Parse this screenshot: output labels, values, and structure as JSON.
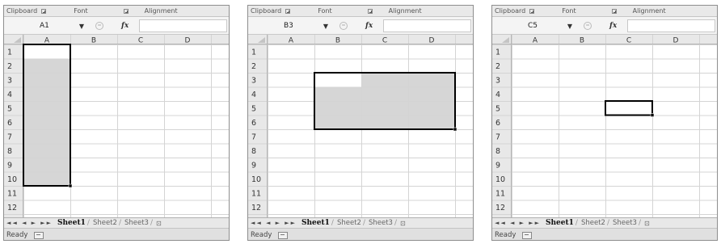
{
  "ribbon_groups": [
    "Clipboard",
    "Font",
    "Alignment"
  ],
  "columns": [
    "A",
    "B",
    "C",
    "D"
  ],
  "rows": [
    "1",
    "2",
    "3",
    "4",
    "5",
    "6",
    "7",
    "8",
    "9",
    "10",
    "11",
    "12"
  ],
  "sheet_tabs": [
    "Sheet1",
    "Sheet2",
    "Sheet3"
  ],
  "status_text": "Ready",
  "formula_symbol": "fx",
  "colors": {
    "selection_fill": "#d6d6d6",
    "selection_border": "#000000",
    "header_bg": "#e8e8e8",
    "gridline": "#d4d4d4"
  },
  "panels": [
    {
      "name_box": "A1",
      "selection": {
        "range": "A1:A10",
        "active_cell": "A1"
      }
    },
    {
      "name_box": "B3",
      "selection": {
        "range": "B3:D6",
        "active_cell": "B3"
      }
    },
    {
      "name_box": "C5",
      "selection": {
        "range": "C5",
        "active_cell": "C5"
      }
    }
  ]
}
